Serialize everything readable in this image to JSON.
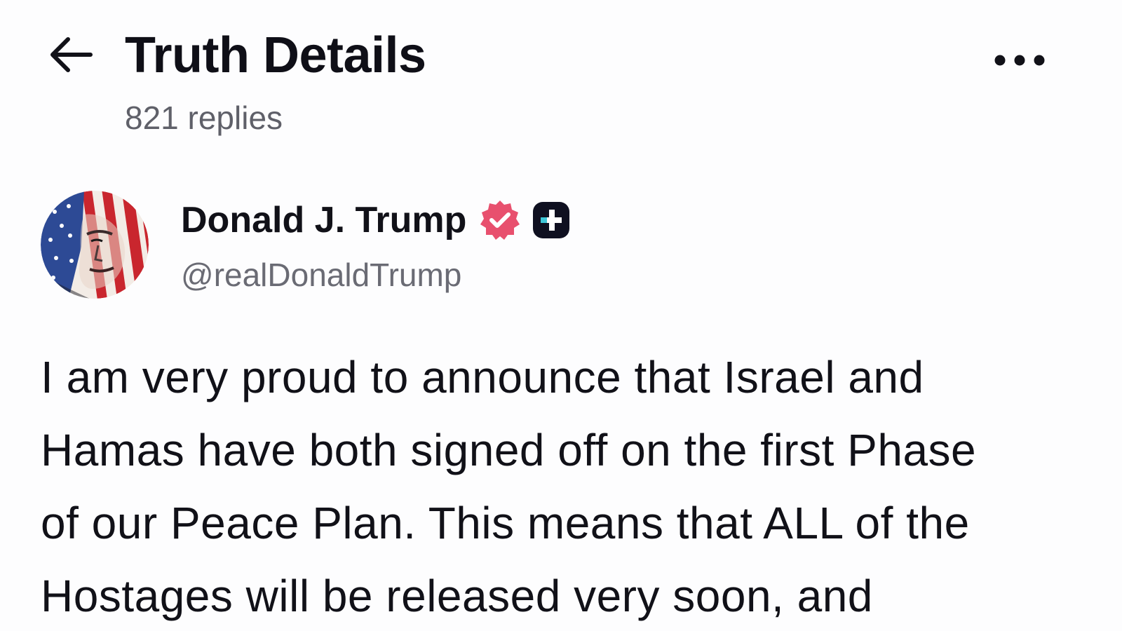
{
  "header": {
    "title": "Truth Details",
    "replies": "821 replies",
    "back_icon": "arrow-left-icon",
    "more_icon": "more-horizontal-icon"
  },
  "author": {
    "name": "Donald J. Trump",
    "handle": "@realDonaldTrump",
    "avatar_icon": "avatar-flag-portrait",
    "verified_icon": "verified-badge-icon",
    "plus_icon": "plus-badge-icon",
    "verified_color": "#e8506e",
    "plus_color": "#0f1020"
  },
  "post": {
    "lines": [
      "I am very proud to announce that Israel and",
      "Hamas have both signed off on the first Phase",
      "of our Peace Plan. This means that ALL of the",
      "Hostages will be released very soon, and"
    ]
  },
  "colors": {
    "background": "#fdfdfe",
    "text": "#111118",
    "muted": "#5f6069"
  }
}
